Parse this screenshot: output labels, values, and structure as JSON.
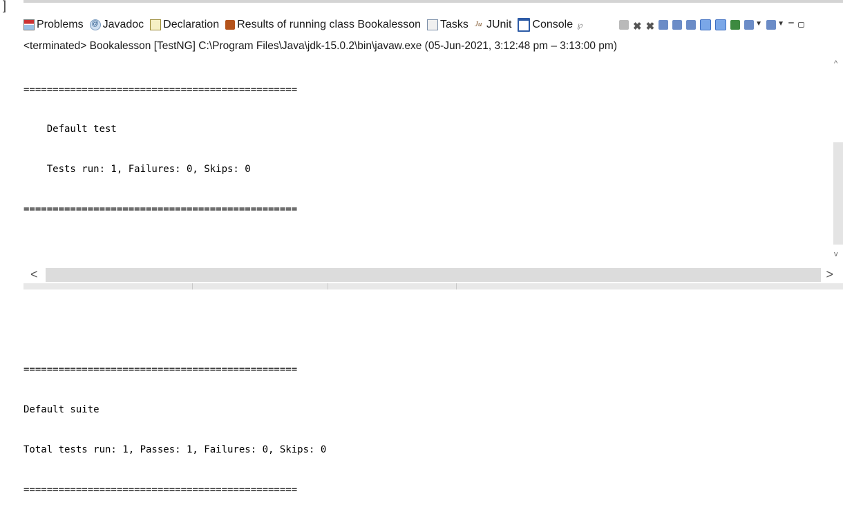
{
  "tabs": [
    {
      "label": "Problems",
      "icon": "problems-icon"
    },
    {
      "label": "Javadoc",
      "icon": "javadoc-icon"
    },
    {
      "label": "Declaration",
      "icon": "declaration-icon"
    },
    {
      "label": "Results of running class Bookalesson",
      "icon": "testng-results-icon"
    },
    {
      "label": "Tasks",
      "icon": "tasks-icon"
    },
    {
      "label": "JUnit",
      "icon": "junit-icon"
    },
    {
      "label": "Console",
      "icon": "console-icon",
      "active": true
    }
  ],
  "console_close_glyph": "℘",
  "status": "<terminated> Bookalesson [TestNG] C:\\Program Files\\Java\\jdk-15.0.2\\bin\\javaw.exe  (05-Jun-2021, 3:12:48 pm – 3:13:00 pm)",
  "console": {
    "lines": [
      "===============================================",
      "    Default test",
      "    Tests run: 1, Failures: 0, Skips: 0",
      "===============================================",
      "",
      "",
      "",
      "===============================================",
      "Default suite",
      "Total tests run: 1, Passes: 1, Failures: 0, Skips: 0",
      "==============================================="
    ]
  },
  "toolbar_icons": [
    "terminate-icon",
    "remove-launch-icon",
    "remove-all-terminated-icon",
    "scroll-lock-icon",
    "word-wrap-icon",
    "show-stdout-icon",
    "show-stderr-icon",
    "pin-console-icon",
    "display-selected-console-icon",
    "open-console-icon",
    "view-menu-icon",
    "minimize-icon",
    "maximize-icon"
  ],
  "colors": {
    "console_icon": "#2d5ba6",
    "results_icon": "#b4531b"
  }
}
